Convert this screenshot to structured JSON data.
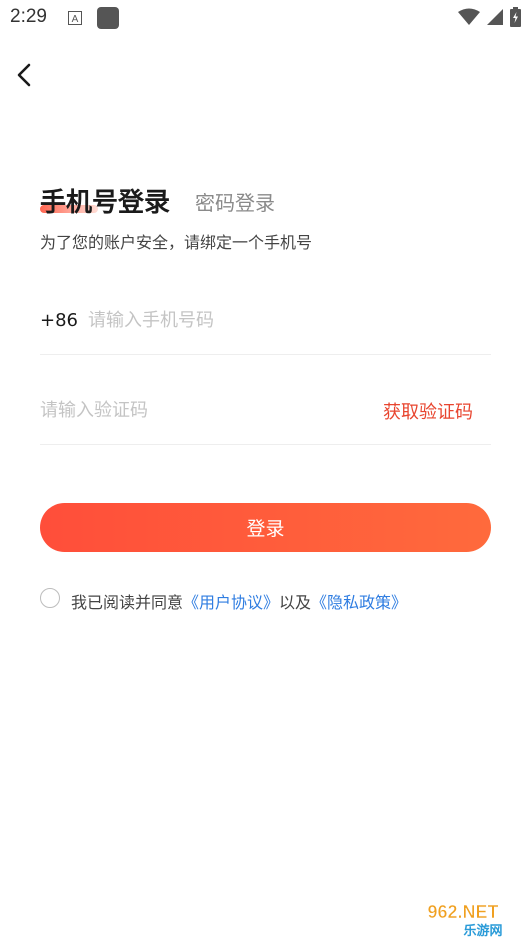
{
  "status_bar": {
    "time": "2:29",
    "a_icon_letter": "A"
  },
  "tabs": {
    "active": "手机号登录",
    "inactive": "密码登录"
  },
  "subtitle": "为了您的账户安全，请绑定一个手机号",
  "phone": {
    "country_code": "+86",
    "placeholder": "请输入手机号码",
    "value": ""
  },
  "code": {
    "placeholder": "请输入验证码",
    "value": "",
    "get_code_label": "获取验证码"
  },
  "login_button": "登录",
  "agreement": {
    "prefix": "我已阅读并同意",
    "user_agreement": "《用户协议》",
    "and": "以及",
    "privacy_policy": "《隐私政策》"
  },
  "watermark": {
    "text_top": "962.NET",
    "text_bottom": "乐游网"
  },
  "colors": {
    "accent": "#e8452f",
    "button_gradient_start": "#ff4e3a",
    "button_gradient_end": "#ff6a3c",
    "link": "#2f7de1"
  }
}
